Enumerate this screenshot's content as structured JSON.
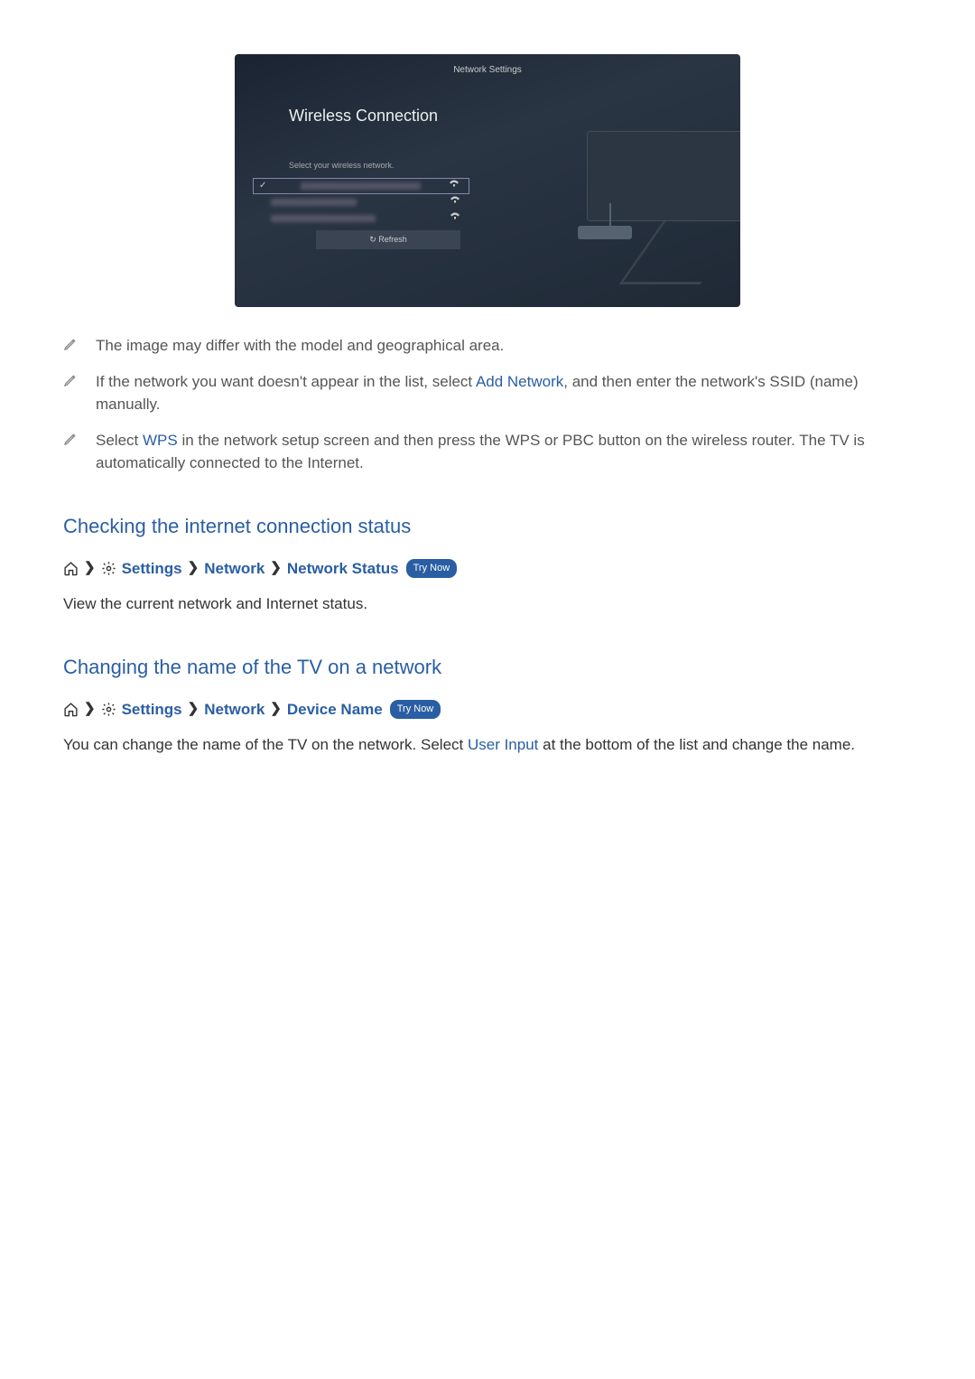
{
  "tv_screenshot": {
    "title": "Network Settings",
    "heading": "Wireless Connection",
    "instruction": "Select your wireless network.",
    "refresh": "↻  Refresh"
  },
  "notes": {
    "n1": "The image may differ with the model and geographical area.",
    "n2a": "If the network you want doesn't appear in the list, select ",
    "n2_highlight": "Add Network",
    "n2b": ", and then enter the network's SSID (name) manually.",
    "n3a": "Select ",
    "n3_highlight": "WPS",
    "n3b": " in the network setup screen and then press the WPS or PBC button on the wireless router. The TV is automatically connected to the Internet."
  },
  "section1": {
    "heading": "Checking the internet connection status",
    "path_settings": "Settings",
    "path_network": "Network",
    "path_status": "Network Status",
    "try_now": "Try Now",
    "body": "View the current network and Internet status."
  },
  "section2": {
    "heading": "Changing the name of the TV on a network",
    "path_settings": "Settings",
    "path_network": "Network",
    "path_device": "Device Name",
    "try_now": "Try Now",
    "body_a": "You can change the name of the TV on the network. Select ",
    "body_highlight": "User Input",
    "body_b": " at the bottom of the list and change the name."
  }
}
